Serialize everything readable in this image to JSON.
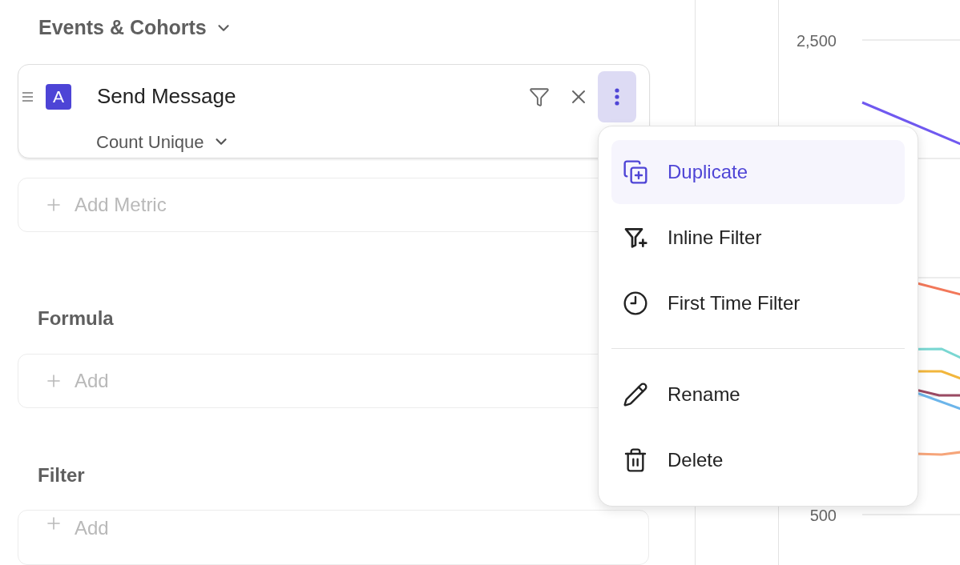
{
  "events_section": {
    "title": "Events & Cohorts"
  },
  "metric": {
    "badge": "A",
    "name": "Send Message",
    "aggregation": "Count Unique",
    "menu_open": true
  },
  "add_metric": {
    "label": "Add Metric"
  },
  "formula": {
    "title": "Formula",
    "add_label": "Add"
  },
  "filter": {
    "title": "Filter",
    "add_label": "Add"
  },
  "menu": {
    "groups": [
      [
        {
          "kind": "duplicate",
          "label": "Duplicate",
          "selected": true
        },
        {
          "kind": "inline-filter",
          "label": "Inline Filter",
          "selected": false
        },
        {
          "kind": "first-time",
          "label": "First Time Filter",
          "selected": false
        }
      ],
      [
        {
          "kind": "rename",
          "label": "Rename",
          "selected": false
        },
        {
          "kind": "delete",
          "label": "Delete",
          "selected": false
        }
      ]
    ]
  },
  "chart": {
    "axis_labels": [
      {
        "kind": "top",
        "label": "2,500"
      },
      {
        "kind": "bottom",
        "label": "500"
      }
    ]
  }
}
